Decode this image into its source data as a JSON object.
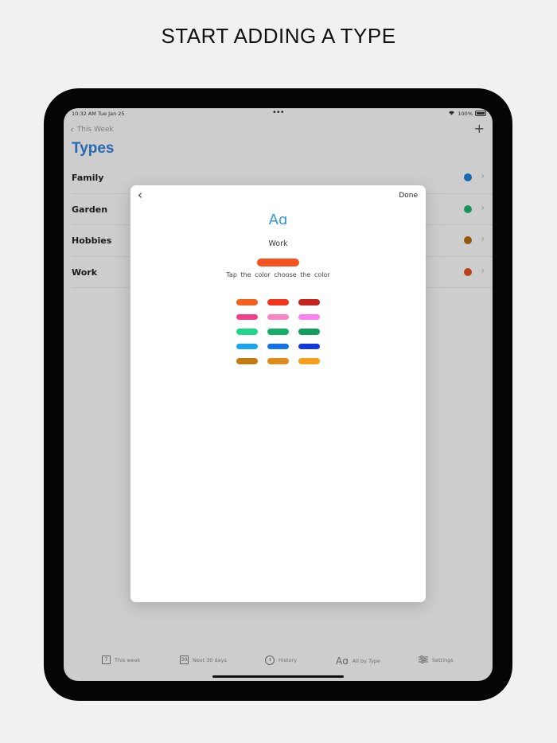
{
  "headline": "START ADDING A TYPE",
  "status_bar": {
    "time": "10:32 AM",
    "date": "Tue Jan 25",
    "battery": "100%"
  },
  "nav": {
    "back_label": "This Week"
  },
  "page_title": "Types",
  "types": [
    {
      "label": "Family",
      "color": "#1e7fd6"
    },
    {
      "label": "Garden",
      "color": "#20b06a"
    },
    {
      "label": "Hobbies",
      "color": "#b06a10"
    },
    {
      "label": "Work",
      "color": "#e0501c"
    }
  ],
  "modal": {
    "done_label": "Done",
    "glyph": "Aɑ",
    "type_name": "Work",
    "selected_color": "#f4521e",
    "hint": "Tap the color choose the color",
    "palette": [
      "#f4601f",
      "#f0351a",
      "#c4261e",
      "#f0408a",
      "#f784c4",
      "#f882f2",
      "#1fd68a",
      "#17ae6c",
      "#139d5d",
      "#19a6ef",
      "#1572e6",
      "#1238de",
      "#c47a12",
      "#e08c1a",
      "#f5a01c"
    ]
  },
  "tabs": [
    {
      "label": "This week",
      "icon": "calendar-7-icon",
      "icon_text": "7"
    },
    {
      "label": "Next 30 days",
      "icon": "calendar-30-icon",
      "icon_text": "30"
    },
    {
      "label": "History",
      "icon": "clock-icon"
    },
    {
      "label": "All by Type",
      "icon": "type-aa-icon",
      "icon_text": "Aɑ"
    },
    {
      "label": "Settings",
      "icon": "sliders-icon"
    }
  ]
}
